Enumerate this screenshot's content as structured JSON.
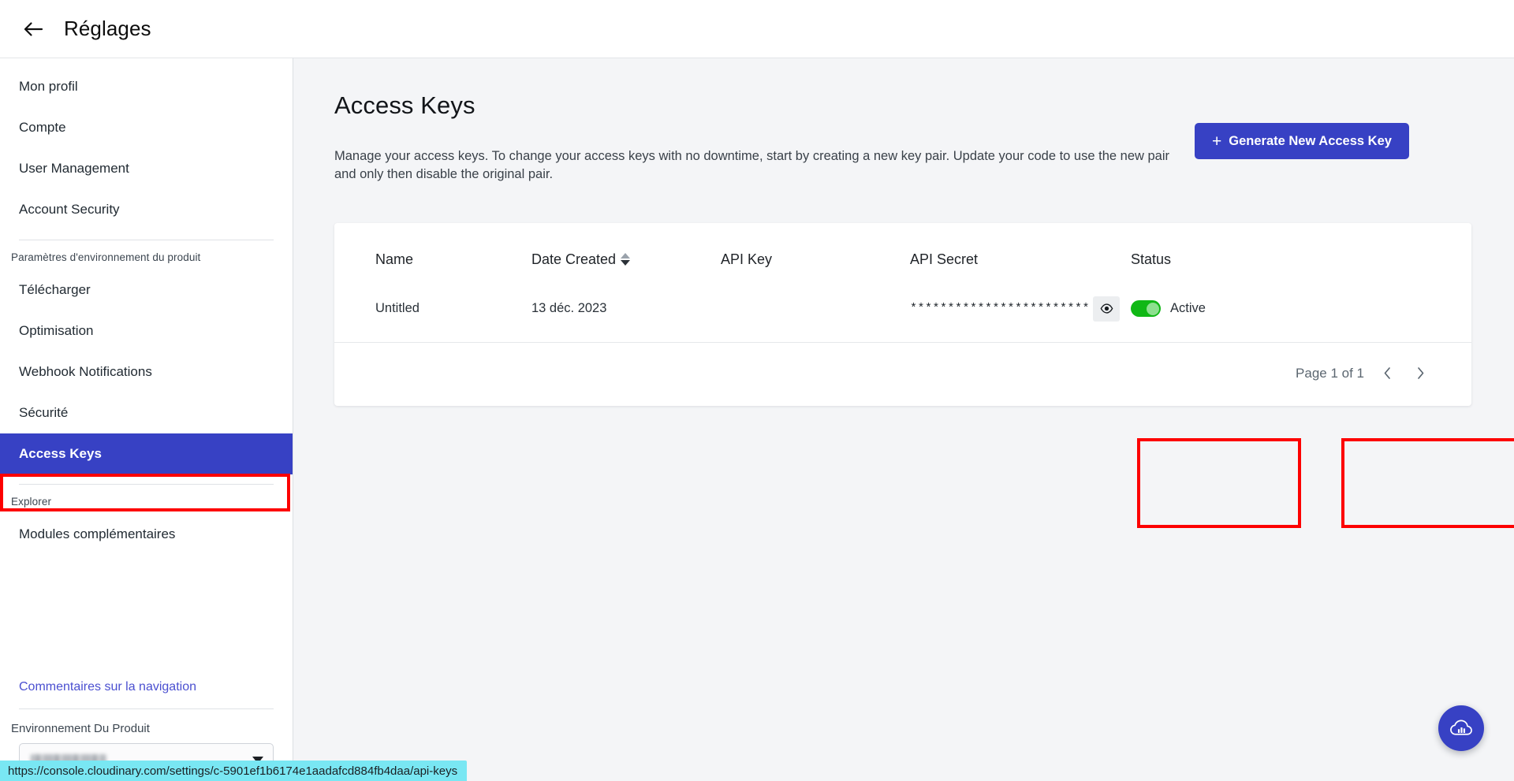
{
  "topbar": {
    "back_icon": "arrow-left-icon",
    "title": "Réglages"
  },
  "sidebar": {
    "primary_items": [
      {
        "label": "Mon profil"
      },
      {
        "label": "Compte"
      },
      {
        "label": "User Management"
      },
      {
        "label": "Account Security"
      }
    ],
    "product_group_label": "Paramètres d'environnement du produit",
    "product_items": [
      {
        "label": "Télécharger"
      },
      {
        "label": "Optimisation"
      },
      {
        "label": "Webhook Notifications"
      },
      {
        "label": "Sécurité"
      },
      {
        "label": "Access Keys",
        "active": true
      }
    ],
    "explorer_group_label": "Explorer",
    "explorer_items": [
      {
        "label": "Modules complémentaires"
      }
    ],
    "feedback_link": "Commentaires sur la navigation",
    "env_label": "Environnement Du Produit",
    "env_selected_value": "",
    "env_chevron_icon": "chevron-down-icon"
  },
  "main": {
    "title": "Access Keys",
    "description": "Manage your access keys. To change your access keys with no downtime, start by creating a new key pair. Update your code to use the new pair and only then disable the original pair.",
    "generate_button": {
      "plus": "+",
      "label": "Generate New Access Key"
    }
  },
  "table": {
    "columns": [
      {
        "key": "name",
        "label": "Name",
        "sortable": false
      },
      {
        "key": "date_created",
        "label": "Date Created",
        "sortable": true,
        "sort_icon": "sort-updown-icon"
      },
      {
        "key": "api_key",
        "label": "API Key",
        "sortable": false
      },
      {
        "key": "api_secret",
        "label": "API Secret",
        "sortable": false
      },
      {
        "key": "status",
        "label": "Status",
        "sortable": false
      }
    ],
    "rows": [
      {
        "name": "Untitled",
        "date_created": "13 déc. 2023",
        "api_key": "",
        "api_secret": "************************",
        "reveal_icon": "eye-icon",
        "status_label": "Active",
        "status_active": true
      }
    ]
  },
  "pagination": {
    "text": "Page 1 of 1",
    "prev_icon": "chevron-left-icon",
    "next_icon": "chevron-right-icon"
  },
  "fab": {
    "icon": "cloudinary-cloud-icon"
  },
  "statusbar": {
    "url": "https://console.cloudinary.com/settings/c-5901ef1b6174e1aadafcd884fb4daa/api-keys"
  },
  "colors": {
    "accent": "#3741c4",
    "annotation": "#fd0000",
    "status_active": "#10b815",
    "statusbar_bg": "#79e7f3",
    "link": "#4a4fd0"
  }
}
